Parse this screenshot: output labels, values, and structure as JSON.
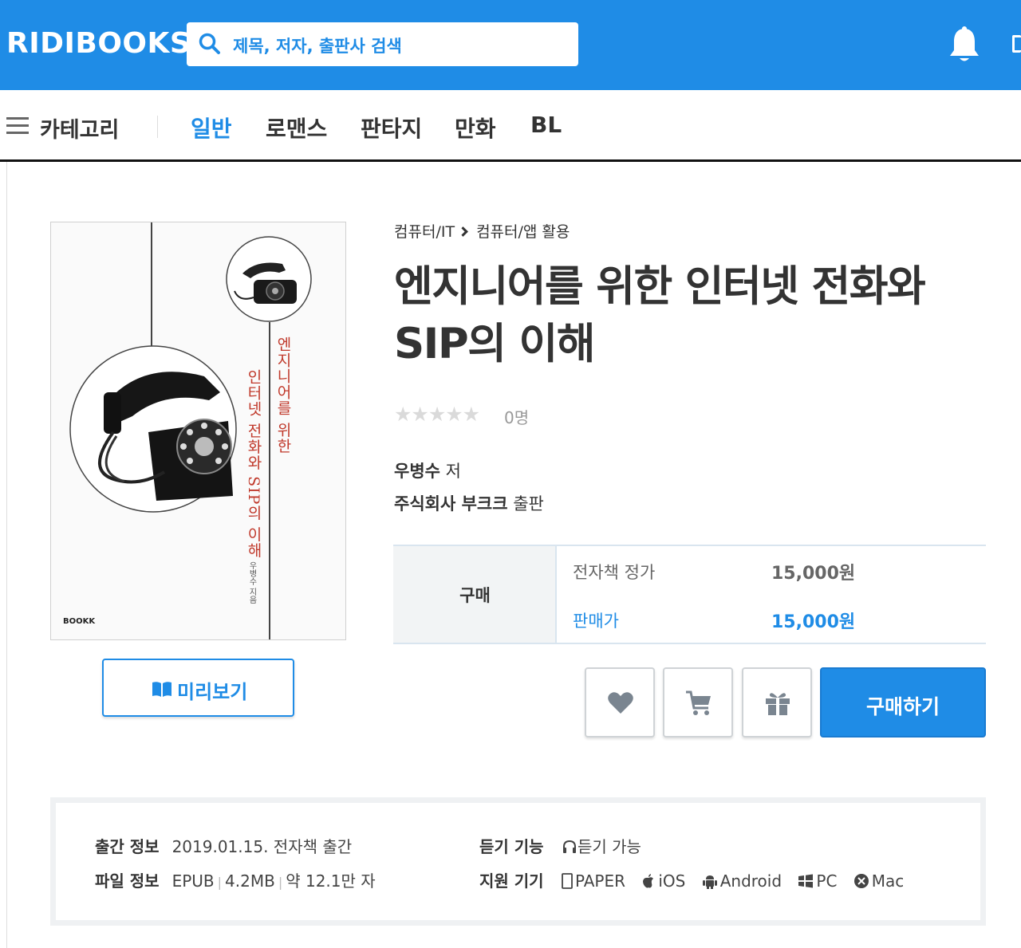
{
  "header": {
    "logo": "RIDIBOOKS",
    "search_placeholder": "제목, 저자, 출판사 검색",
    "brand_color": "#1f8ce6"
  },
  "nav": {
    "category_label": "카테고리",
    "items": [
      {
        "label": "일반",
        "active": true
      },
      {
        "label": "로맨스",
        "active": false
      },
      {
        "label": "판타지",
        "active": false
      },
      {
        "label": "만화",
        "active": false
      },
      {
        "label": "BL",
        "active": false
      }
    ]
  },
  "cover": {
    "title_line1": "엔지니어를 위한",
    "title_line2": "인터넷 전화와 SIP의 이해",
    "author": "우병수 지음",
    "publisher_mark": "BOOKK"
  },
  "preview": {
    "label": "미리보기"
  },
  "breadcrumb": {
    "level1": "컴퓨터/IT",
    "level2": "컴퓨터/앱 활용"
  },
  "book": {
    "title_line1": "엔지니어를 위한 인터넷 전화와",
    "title_line2": "SIP의 이해",
    "rating_count": "0명",
    "author_name": "우병수",
    "author_suffix": " 저",
    "publisher_name": "주식회사 부크크",
    "publisher_suffix": " 출판"
  },
  "price": {
    "head": "구매",
    "list_label": "전자책 정가",
    "list_value": "15,000원",
    "sale_label": "판매가",
    "sale_value": "15,000원"
  },
  "actions": {
    "wishlist_icon": "heart-icon",
    "cart_icon": "cart-icon",
    "gift_icon": "gift-icon",
    "buy_label": "구매하기"
  },
  "meta": {
    "release_key": "출간 정보",
    "release_value": "2019.01.15. 전자책 출간",
    "file_key": "파일 정보",
    "file_format": "EPUB",
    "file_size": "4.2MB",
    "file_length": "약 12.1만 자",
    "listen_key": "듣기 기능",
    "listen_value": "듣기 가능",
    "devices_key": "지원 기기",
    "devices": [
      "PAPER",
      "iOS",
      "Android",
      "PC",
      "Mac"
    ]
  }
}
